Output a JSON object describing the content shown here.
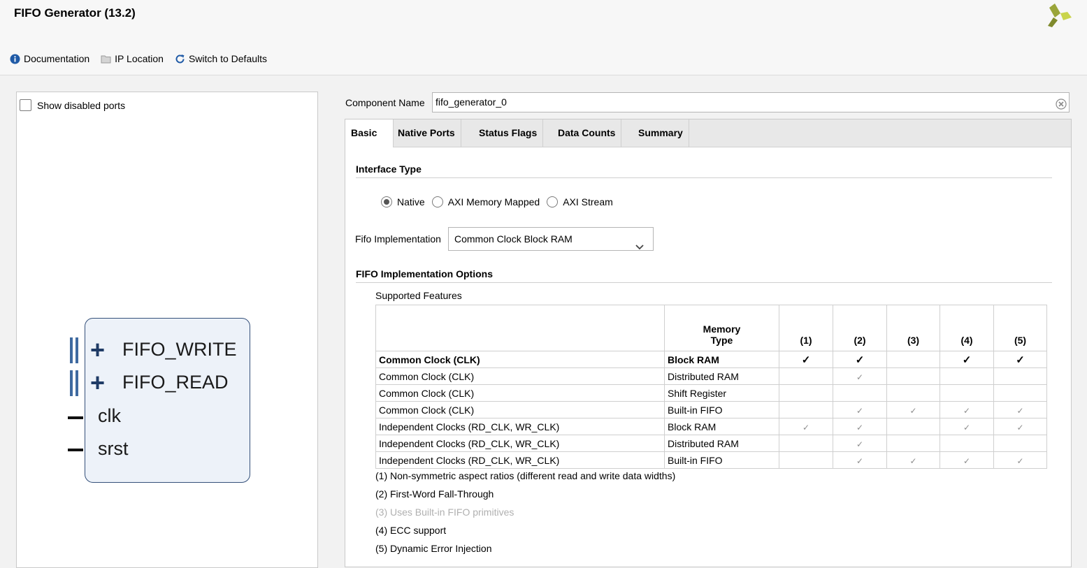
{
  "window": {
    "title": "FIFO Generator (13.2)"
  },
  "toolbar": {
    "documentation": "Documentation",
    "ip_location": "IP Location",
    "switch_defaults": "Switch to Defaults"
  },
  "left_panel": {
    "show_disabled_ports": "Show disabled ports",
    "show_disabled_checked": false,
    "ports": [
      "FIFO_WRITE",
      "FIFO_READ",
      "clk",
      "srst"
    ]
  },
  "component": {
    "label": "Component Name",
    "value": "fifo_generator_0"
  },
  "tabs": [
    {
      "label": "Basic",
      "active": true
    },
    {
      "label": "Native Ports",
      "active": false
    },
    {
      "label": "Status Flags",
      "active": false
    },
    {
      "label": "Data Counts",
      "active": false
    },
    {
      "label": "Summary",
      "active": false
    }
  ],
  "interface": {
    "title": "Interface Type",
    "options": [
      "Native",
      "AXI Memory Mapped",
      "AXI Stream"
    ],
    "selected": "Native"
  },
  "fifo_impl": {
    "label": "Fifo Implementation",
    "value": "Common Clock Block RAM"
  },
  "impl_options": {
    "title": "FIFO Implementation Options",
    "supported_features": "Supported Features",
    "headers": [
      "Memory Type",
      "(1)",
      "(2)",
      "(3)",
      "(4)",
      "(5)"
    ],
    "memory_type_header": [
      "Memory",
      "Type"
    ],
    "rows": [
      {
        "clock": "Common Clock (CLK)",
        "memory": "Block RAM",
        "bold": true,
        "checks": [
          true,
          true,
          false,
          true,
          true
        ]
      },
      {
        "clock": "Common Clock (CLK)",
        "memory": "Distributed RAM",
        "bold": false,
        "checks": [
          false,
          true,
          false,
          false,
          false
        ]
      },
      {
        "clock": "Common Clock (CLK)",
        "memory": "Shift Register",
        "bold": false,
        "checks": [
          false,
          false,
          false,
          false,
          false
        ]
      },
      {
        "clock": "Common Clock (CLK)",
        "memory": "Built-in FIFO",
        "bold": false,
        "checks": [
          false,
          true,
          true,
          true,
          true
        ]
      },
      {
        "clock": "Independent Clocks (RD_CLK, WR_CLK)",
        "memory": "Block RAM",
        "bold": false,
        "checks": [
          true,
          true,
          false,
          true,
          true
        ]
      },
      {
        "clock": "Independent Clocks (RD_CLK, WR_CLK)",
        "memory": "Distributed RAM",
        "bold": false,
        "checks": [
          false,
          true,
          false,
          false,
          false
        ]
      },
      {
        "clock": "Independent Clocks (RD_CLK, WR_CLK)",
        "memory": "Built-in FIFO",
        "bold": false,
        "checks": [
          false,
          true,
          true,
          true,
          true
        ]
      }
    ],
    "notes": [
      {
        "text": "(1) Non-symmetric aspect ratios (different read and write data widths)",
        "disabled": false
      },
      {
        "text": "(2) First-Word Fall-Through",
        "disabled": false
      },
      {
        "text": "(3) Uses Built-in FIFO primitives",
        "disabled": true
      },
      {
        "text": "(4) ECC support",
        "disabled": false
      },
      {
        "text": "(5) Dynamic Error Injection",
        "disabled": false
      }
    ]
  }
}
